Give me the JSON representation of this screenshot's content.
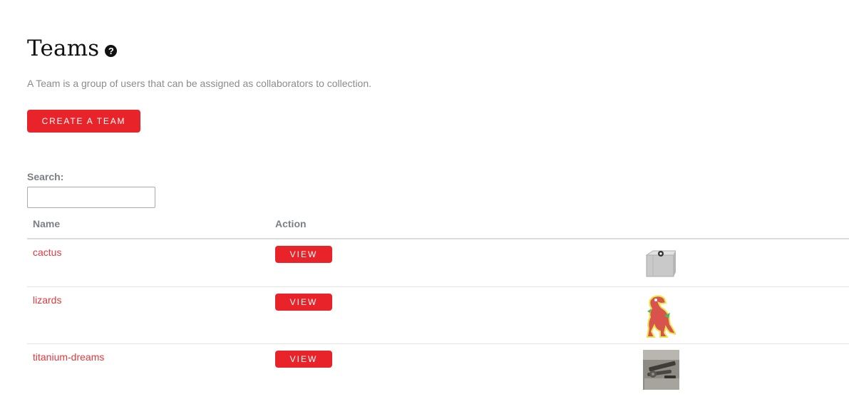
{
  "header": {
    "title": "Teams",
    "help_icon": "question-circle-icon",
    "description": "A Team is a group of users that can be assigned as collaborators to collection."
  },
  "actions": {
    "create_label": "CREATE A TEAM"
  },
  "search": {
    "label": "Search:",
    "value": "",
    "placeholder": ""
  },
  "table": {
    "columns": [
      "Name",
      "Action"
    ],
    "rows": [
      {
        "name": "cactus",
        "action_label": "VIEW",
        "thumbnail": "box-image"
      },
      {
        "name": "lizards",
        "action_label": "VIEW",
        "thumbnail": "dinosaur-image"
      },
      {
        "name": "titanium-dreams",
        "action_label": "VIEW",
        "thumbnail": "tools-photo"
      }
    ]
  },
  "colors": {
    "accent": "#e8242a",
    "link": "#e0393e",
    "muted_text": "#8c8c8c",
    "header_text": "#7c8086"
  }
}
